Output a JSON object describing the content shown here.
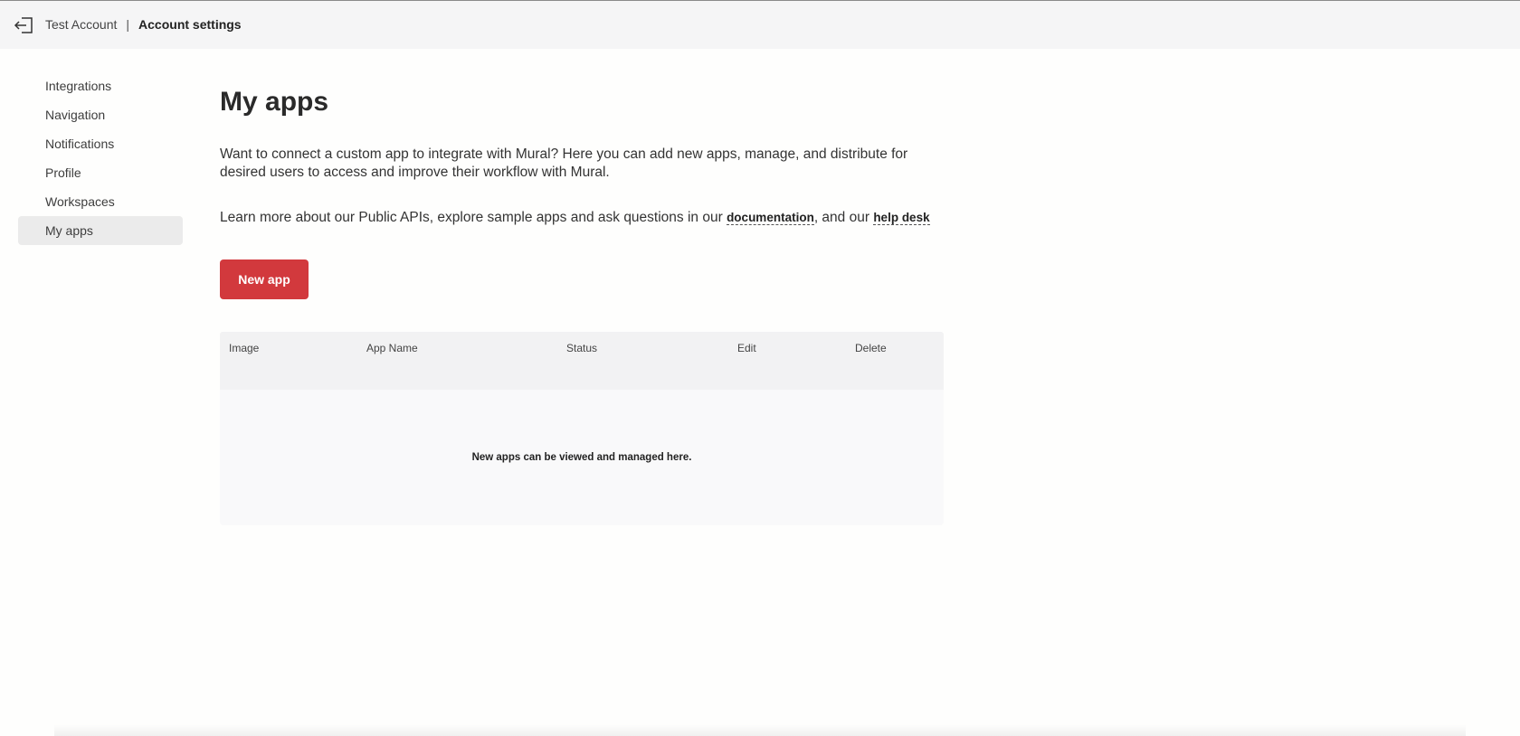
{
  "header": {
    "exit_icon": "exit-arrow-icon",
    "account_name": "Test Account",
    "separator": "|",
    "current_page": "Account settings"
  },
  "sidebar": {
    "items": [
      {
        "label": "Integrations",
        "active": false
      },
      {
        "label": "Navigation",
        "active": false
      },
      {
        "label": "Notifications",
        "active": false
      },
      {
        "label": "Profile",
        "active": false
      },
      {
        "label": "Workspaces",
        "active": false
      },
      {
        "label": "My apps",
        "active": true
      }
    ]
  },
  "main": {
    "title": "My apps",
    "intro": "Want to connect a custom app to integrate with Mural? Here you can add new apps, manage, and distribute for desired users to access and improve their workflow with Mural.",
    "learn_prefix": "Learn more about our Public APIs, explore sample apps and ask questions in our ",
    "documentation_link": "documentation",
    "learn_middle": ", and our ",
    "helpdesk_link": "help desk",
    "new_app_button": "New app",
    "table": {
      "columns": [
        "Image",
        "App Name",
        "Status",
        "Edit",
        "Delete"
      ],
      "empty_message": "New apps can be viewed and managed here."
    }
  },
  "colors": {
    "accent": "#d2393d",
    "header_bg": "#f5f5f6",
    "active_item_bg": "#ebebeb"
  }
}
